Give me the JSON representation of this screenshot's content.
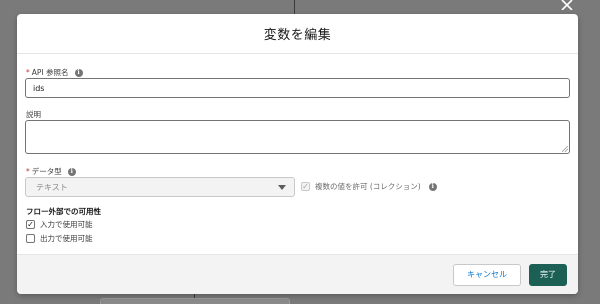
{
  "modal": {
    "title": "変数を編集"
  },
  "fields": {
    "api_name": {
      "required_marker": "*",
      "label": "API 参照名",
      "value": "ids"
    },
    "description": {
      "label": "説明",
      "value": ""
    },
    "data_type": {
      "required_marker": "*",
      "label": "データ型",
      "selected": "テキスト"
    },
    "allow_multiple": {
      "label": "複数の値を許可 (コレクション)",
      "checked": true,
      "disabled": true
    }
  },
  "availability": {
    "title": "フロー外部での可用性",
    "input": {
      "label": "入力で使用可能",
      "checked": true
    },
    "output": {
      "label": "出力で使用可能",
      "checked": false
    }
  },
  "footer": {
    "cancel_label": "キャンセル",
    "done_label": "完了"
  },
  "colors": {
    "brand": "#1b5f55",
    "link": "#0176d3",
    "required": "#c23934",
    "overlay": "#7a7a7a"
  },
  "icons": {
    "close": "close-icon",
    "info": "info-icon",
    "dropdown": "chevron-down-icon",
    "check": "check-icon"
  }
}
